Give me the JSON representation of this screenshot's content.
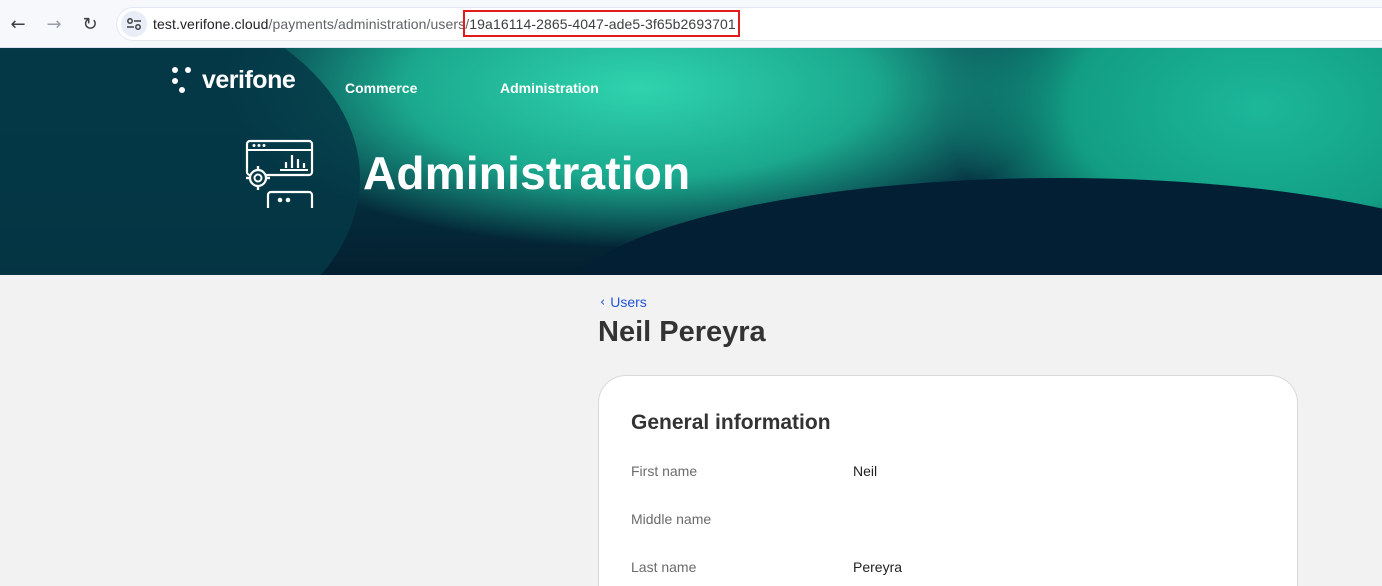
{
  "browser": {
    "url_host": "test.verifone.cloud",
    "url_path": "/payments/administration/users/",
    "url_id": "19a16114-2865-4047-ade5-3f65b2693701"
  },
  "header": {
    "logo_text": "verifone",
    "nav": [
      "Commerce",
      "Administration"
    ],
    "hero_title": "Administration",
    "hero_icon": "admin-dashboard-icon"
  },
  "breadcrumb": {
    "label": "Users"
  },
  "user": {
    "name": "Neil Pereyra"
  },
  "general_info": {
    "title": "General information",
    "fields": [
      {
        "label": "First name",
        "value": "Neil"
      },
      {
        "label": "Middle name",
        "value": ""
      },
      {
        "label": "Last name",
        "value": "Pereyra"
      }
    ]
  },
  "colors": {
    "link": "#2157d6",
    "highlight": "#e11b1b",
    "brand_teal": "#1cb79a"
  }
}
